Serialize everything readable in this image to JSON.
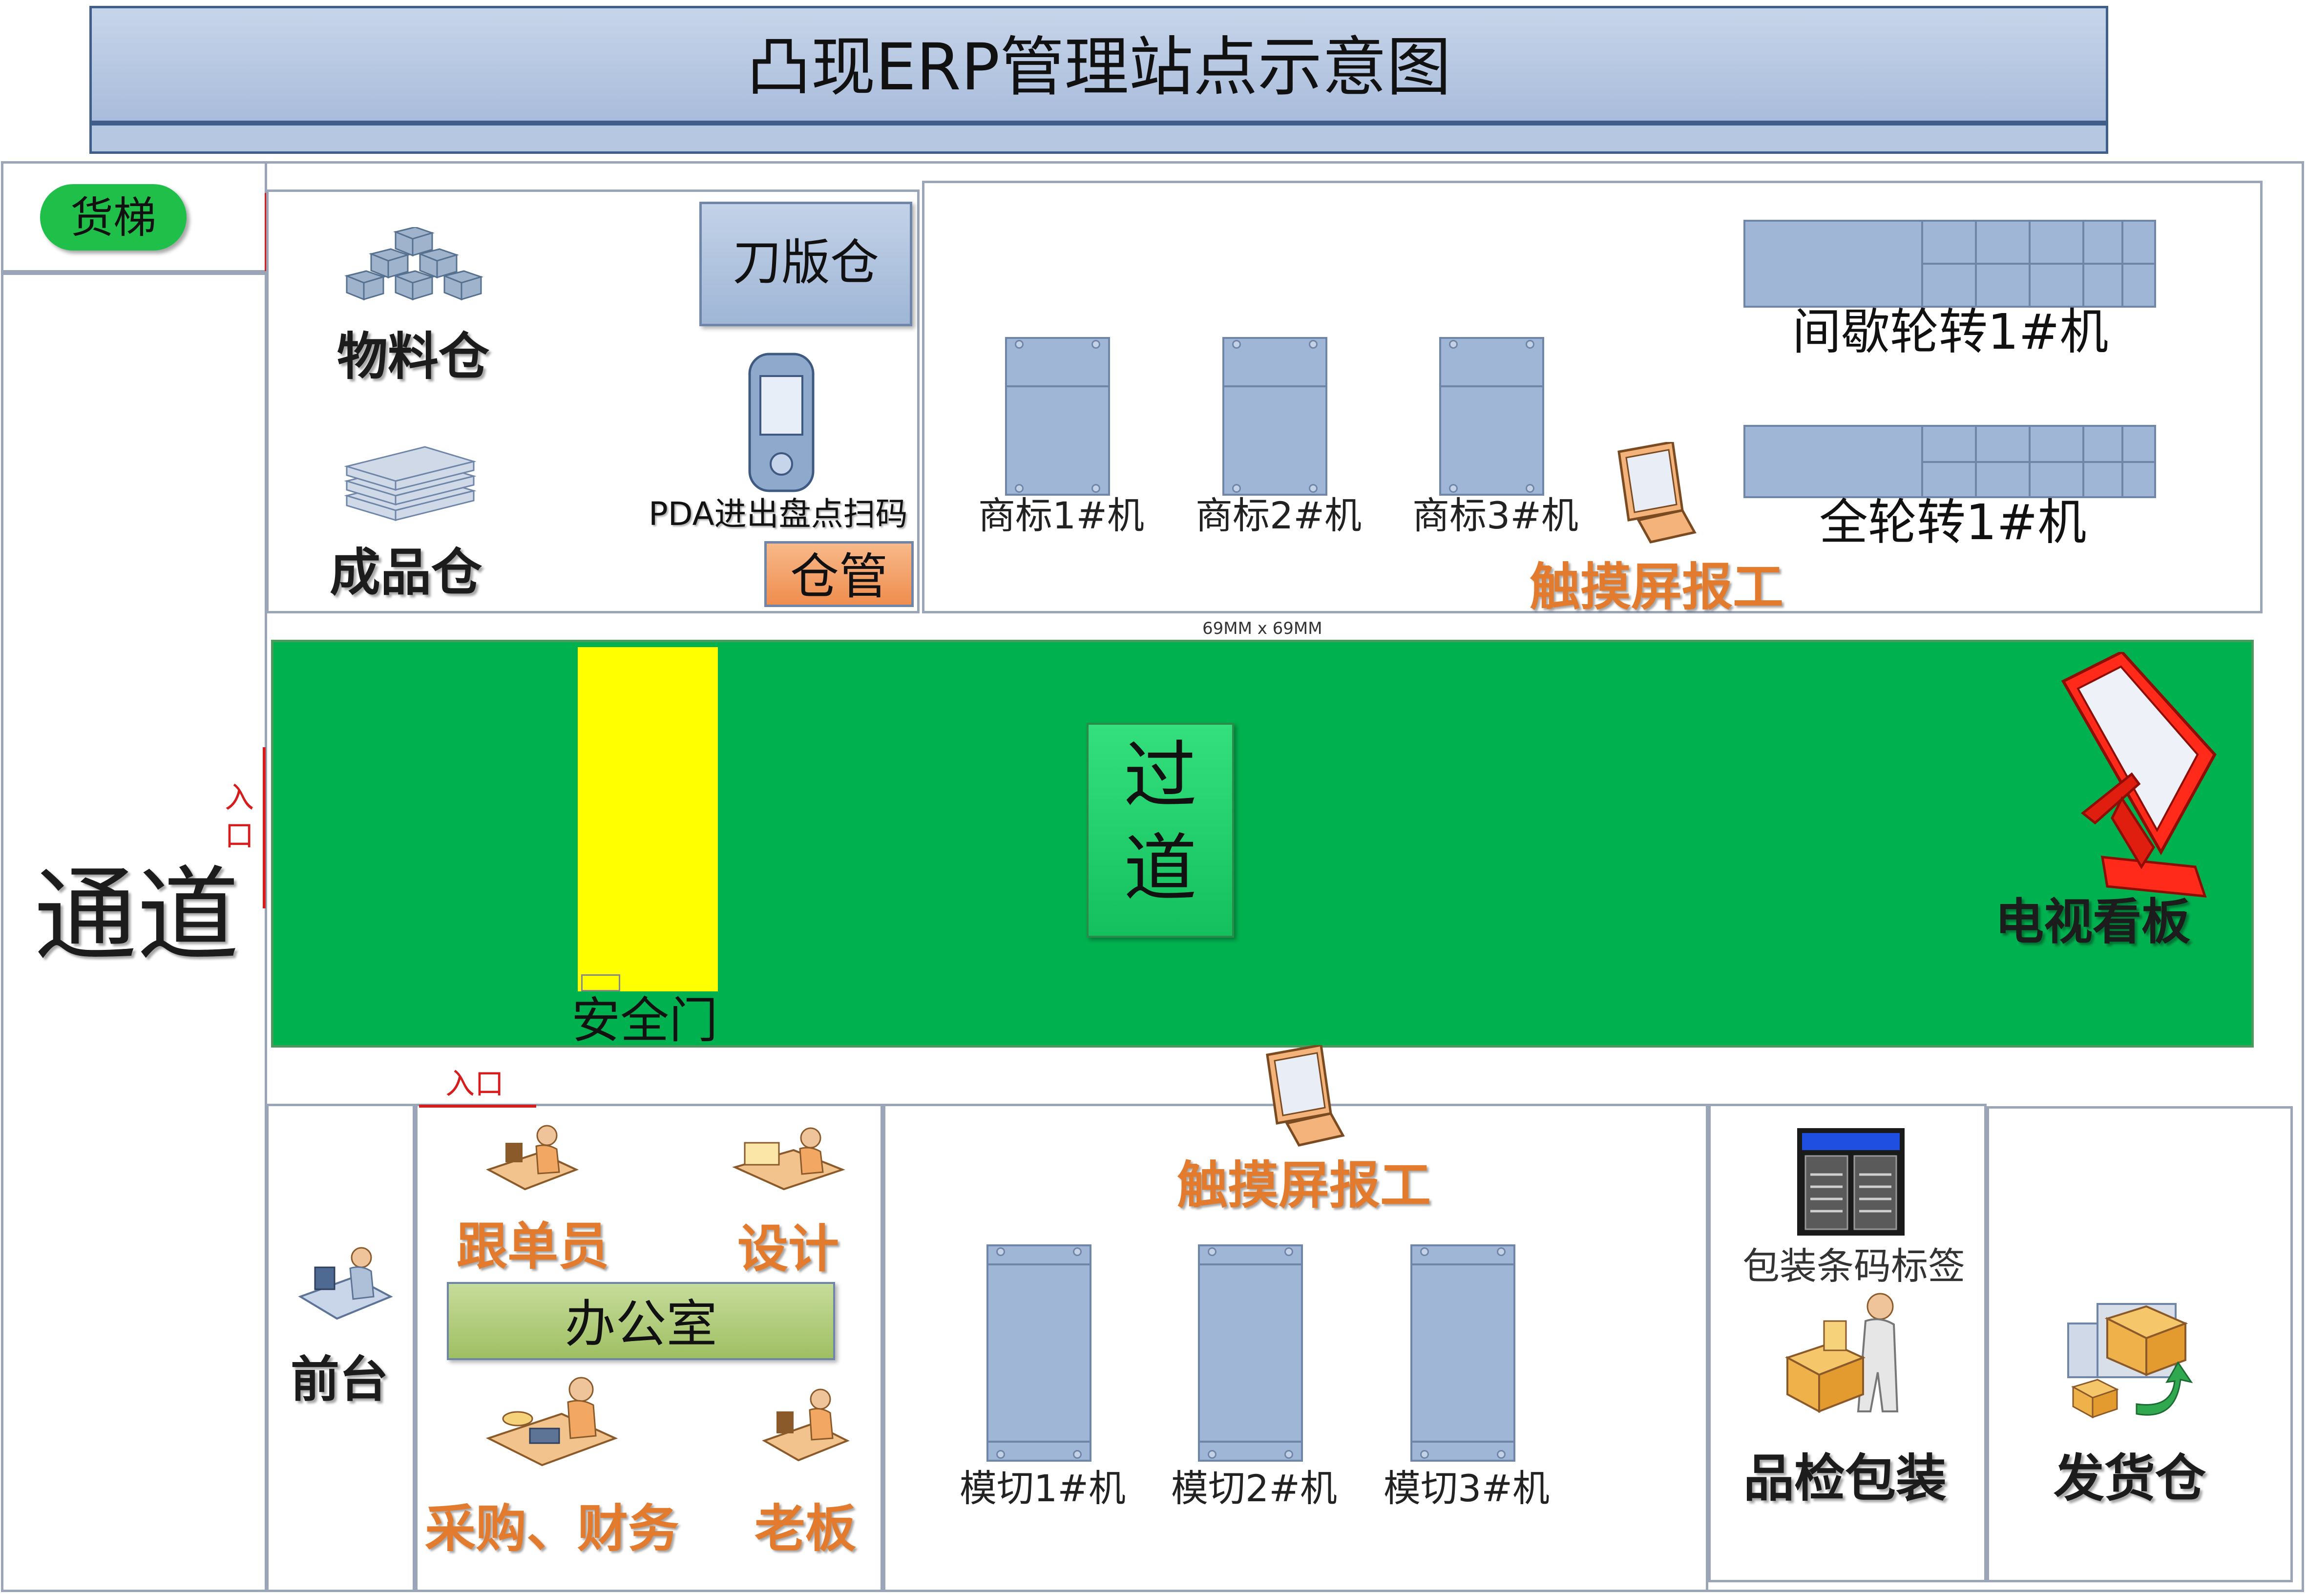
{
  "title": "凸现ERP管理站点示意图",
  "left": {
    "elevator": "货梯",
    "channel": "通道",
    "entry_label": "入口"
  },
  "warehouse": {
    "entry_label": "入口",
    "material": "物料仓",
    "finished": "成品仓",
    "die_board": "刀版仓",
    "pda": "PDA进出盘点扫码",
    "keeper": "仓管"
  },
  "label_area": {
    "machines": [
      "商标1#机",
      "商标2#机",
      "商标3#机"
    ],
    "intermittent": "间歇轮转1#机",
    "full_rotary": "全轮转1#机",
    "touch": "触摸屏报工",
    "size_note": "69MM x 69MM"
  },
  "corridor": {
    "safety_door": "安全门",
    "passage": [
      "过",
      "道"
    ],
    "tv_board": "电视看板"
  },
  "bottom": {
    "reception": "前台",
    "office_entry": "入口",
    "follower": "跟单员",
    "design": "设计",
    "office": "办公室",
    "purchase": "采购、财务",
    "boss": "老板",
    "touch": "触摸屏报工",
    "die_cut": [
      "模切1#机",
      "模切2#机",
      "模切3#机"
    ],
    "barcode": "包装条码标签",
    "qc_pack": "品检包装",
    "shipping": "发货仓"
  },
  "colors": {
    "title_bg": "#b6c7e1",
    "corridor": "#00b14f",
    "safety_door": "#ffff00",
    "elevator": "#1fbf4a",
    "keeper": "#f5a06a",
    "office": "#a9c870",
    "label_orange": "#e27b2e"
  },
  "icons": [
    "boxes-icon",
    "paper-stack-icon",
    "pda-icon",
    "monitor-icon",
    "tv-board-icon",
    "worker-desk-icon",
    "printer-icon",
    "packer-icon",
    "delivery-truck-icon"
  ]
}
